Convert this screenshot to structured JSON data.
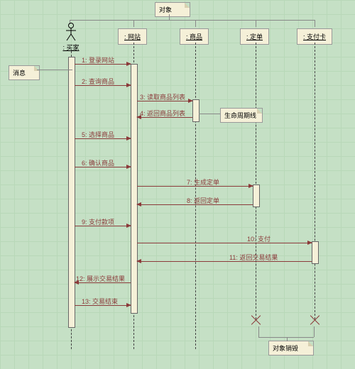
{
  "notes": {
    "objects": "对象",
    "message": "消息",
    "lifecycle": "生命周期线",
    "destroy": "对象销毁"
  },
  "participants": {
    "buyer": ": 买家",
    "website": ": 网站",
    "product": ": 商品",
    "order": ": 定单",
    "card": ": 支付卡"
  },
  "messages": {
    "m1": "1: 登录网站",
    "m2": "2: 查询商品",
    "m3": "3: 读取商品列表",
    "m4": "4: 返回商品列表",
    "m5": "5: 选择商品",
    "m6": "6: 确认商品",
    "m7": "7: 生成定单",
    "m8": "8: 返回定单",
    "m9": "9: 支付款项",
    "m10": "10: 支付",
    "m11": "11: 返回交易结果",
    "m12": "12: 展示交易结果",
    "m13": "13: 交易结束"
  }
}
